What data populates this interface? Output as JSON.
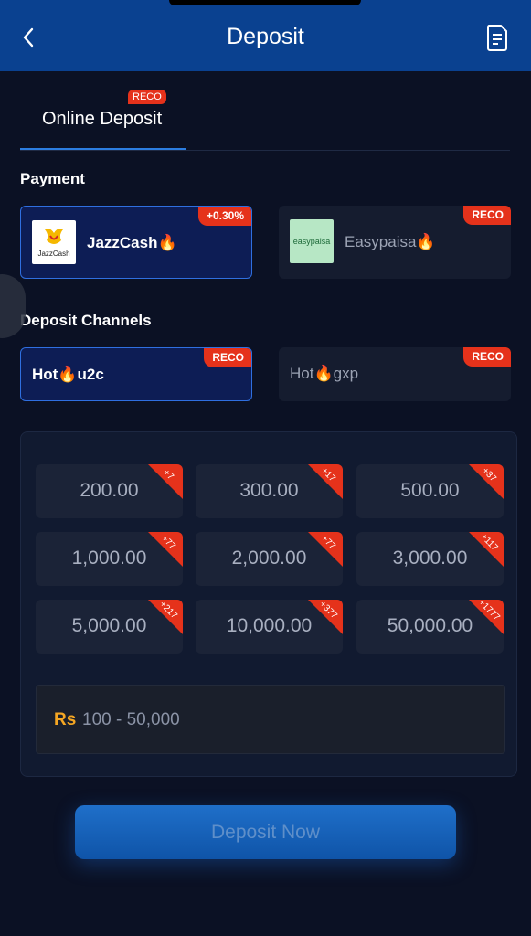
{
  "header": {
    "title": "Deposit"
  },
  "tabs": [
    {
      "label": "Online Deposit",
      "badge": "RECO",
      "active": true
    }
  ],
  "payment": {
    "title": "Payment",
    "methods": [
      {
        "name": "JazzCash🔥",
        "badge": "+0.30%",
        "selected": true,
        "logo_text": "JazzCash"
      },
      {
        "name": "Easypaisa🔥",
        "badge": "RECO",
        "selected": false,
        "logo_text": "easypaisa"
      }
    ]
  },
  "channels": {
    "title": "Deposit Channels",
    "items": [
      {
        "name": "Hot🔥u2c",
        "badge": "RECO",
        "selected": true
      },
      {
        "name": "Hot🔥gxp",
        "badge": "RECO",
        "selected": false
      }
    ]
  },
  "amounts": [
    {
      "value": "200.00",
      "bonus": "+7"
    },
    {
      "value": "300.00",
      "bonus": "+17"
    },
    {
      "value": "500.00",
      "bonus": "+37"
    },
    {
      "value": "1,000.00",
      "bonus": "+77"
    },
    {
      "value": "2,000.00",
      "bonus": "+77"
    },
    {
      "value": "3,000.00",
      "bonus": "+117"
    },
    {
      "value": "5,000.00",
      "bonus": "+217"
    },
    {
      "value": "10,000.00",
      "bonus": "+377"
    },
    {
      "value": "50,000.00",
      "bonus": "+1777"
    }
  ],
  "amount_input": {
    "currency": "Rs",
    "placeholder": "100 - 50,000"
  },
  "submit": {
    "label": "Deposit Now"
  },
  "colors": {
    "accent": "#0a4190",
    "badge": "#e5321b",
    "currency": "#f5a623"
  },
  "icons": {
    "back": "chevron-left-icon",
    "record": "document-icon"
  }
}
